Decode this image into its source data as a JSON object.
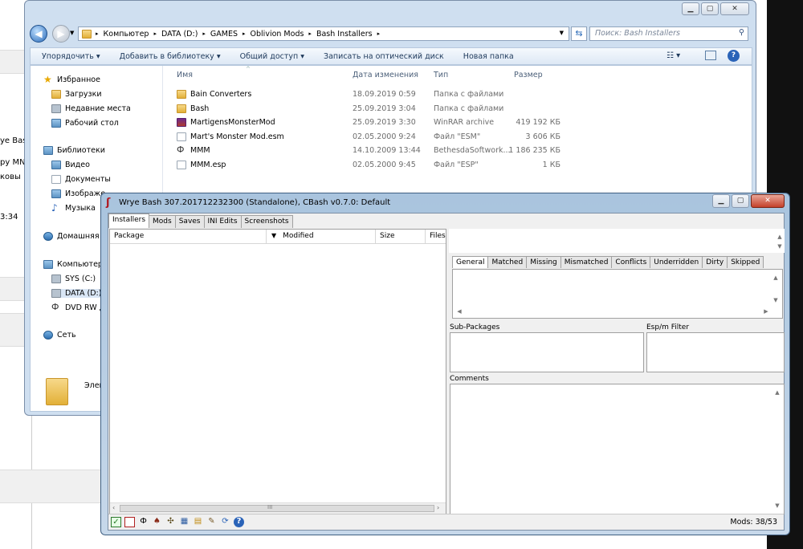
{
  "background": {
    "fragments": [
      "ye Bas",
      "py MN",
      "ковы",
      "3:34"
    ]
  },
  "explorer": {
    "breadcrumb": [
      "Компьютер",
      "DATA (D:)",
      "GAMES",
      "Oblivion Mods",
      "Bash Installers"
    ],
    "search_placeholder": "Поиск: Bash Installers",
    "toolbar": {
      "organize": "Упорядочить ▾",
      "add_library": "Добавить в библиотеку ▾",
      "share": "Общий доступ ▾",
      "burn": "Записать на оптический диск",
      "new_folder": "Новая папка"
    },
    "nav": {
      "favorites": "Избранное",
      "downloads": "Загрузки",
      "recent": "Недавние места",
      "desktop": "Рабочий стол",
      "libraries": "Библиотеки",
      "video": "Видео",
      "documents": "Документы",
      "images": "Изображе",
      "music": "Музыка",
      "homegroup": "Домашняя",
      "computer": "Компьютер",
      "sys": "SYS (C:)",
      "data": "DATA (D:)",
      "dvd": "DVD RW д",
      "network": "Сеть"
    },
    "columns": {
      "name": "Имя",
      "date": "Дата изменения",
      "type": "Тип",
      "size": "Размер"
    },
    "files": [
      {
        "name": "Bain Converters",
        "date": "18.09.2019 0:59",
        "type": "Папка с файлами",
        "size": "",
        "icon": "folder"
      },
      {
        "name": "Bash",
        "date": "25.09.2019 3:04",
        "type": "Папка с файлами",
        "size": "",
        "icon": "folder"
      },
      {
        "name": "MartigensMonsterMod",
        "date": "25.09.2019 3:30",
        "type": "WinRAR archive",
        "size": "419 192 КБ",
        "icon": "rar"
      },
      {
        "name": "Mart's Monster Mod.esm",
        "date": "02.05.2000 9:24",
        "type": "Файл \"ESM\"",
        "size": "3 606 КБ",
        "icon": "doc"
      },
      {
        "name": "MMM",
        "date": "14.10.2009 13:44",
        "type": "BethesdaSoftwork...",
        "size": "1 186 235 КБ",
        "icon": "mmm"
      },
      {
        "name": "MMM.esp",
        "date": "02.05.2000 9:45",
        "type": "Файл \"ESP\"",
        "size": "1 КБ",
        "icon": "doc"
      }
    ],
    "status_label": "Элем"
  },
  "wrye": {
    "title": "Wrye Bash 307.201712232300 (Standalone), CBash v0.7.0: Default",
    "tabs": [
      "Installers",
      "Mods",
      "Saves",
      "INI Edits",
      "Screenshots"
    ],
    "columns": {
      "package": "Package",
      "modified": "Modified",
      "size": "Size",
      "files": "Files"
    },
    "sort_arrow": "▼",
    "subtabs": [
      "General",
      "Matched",
      "Missing",
      "Mismatched",
      "Conflicts",
      "Underridden",
      "Dirty",
      "Skipped"
    ],
    "labels": {
      "subpackages": "Sub-Packages",
      "espm_filter": "Esp/m Filter",
      "comments": "Comments"
    },
    "status_mods": "Mods: 38/53",
    "scroll_grip": "III"
  }
}
